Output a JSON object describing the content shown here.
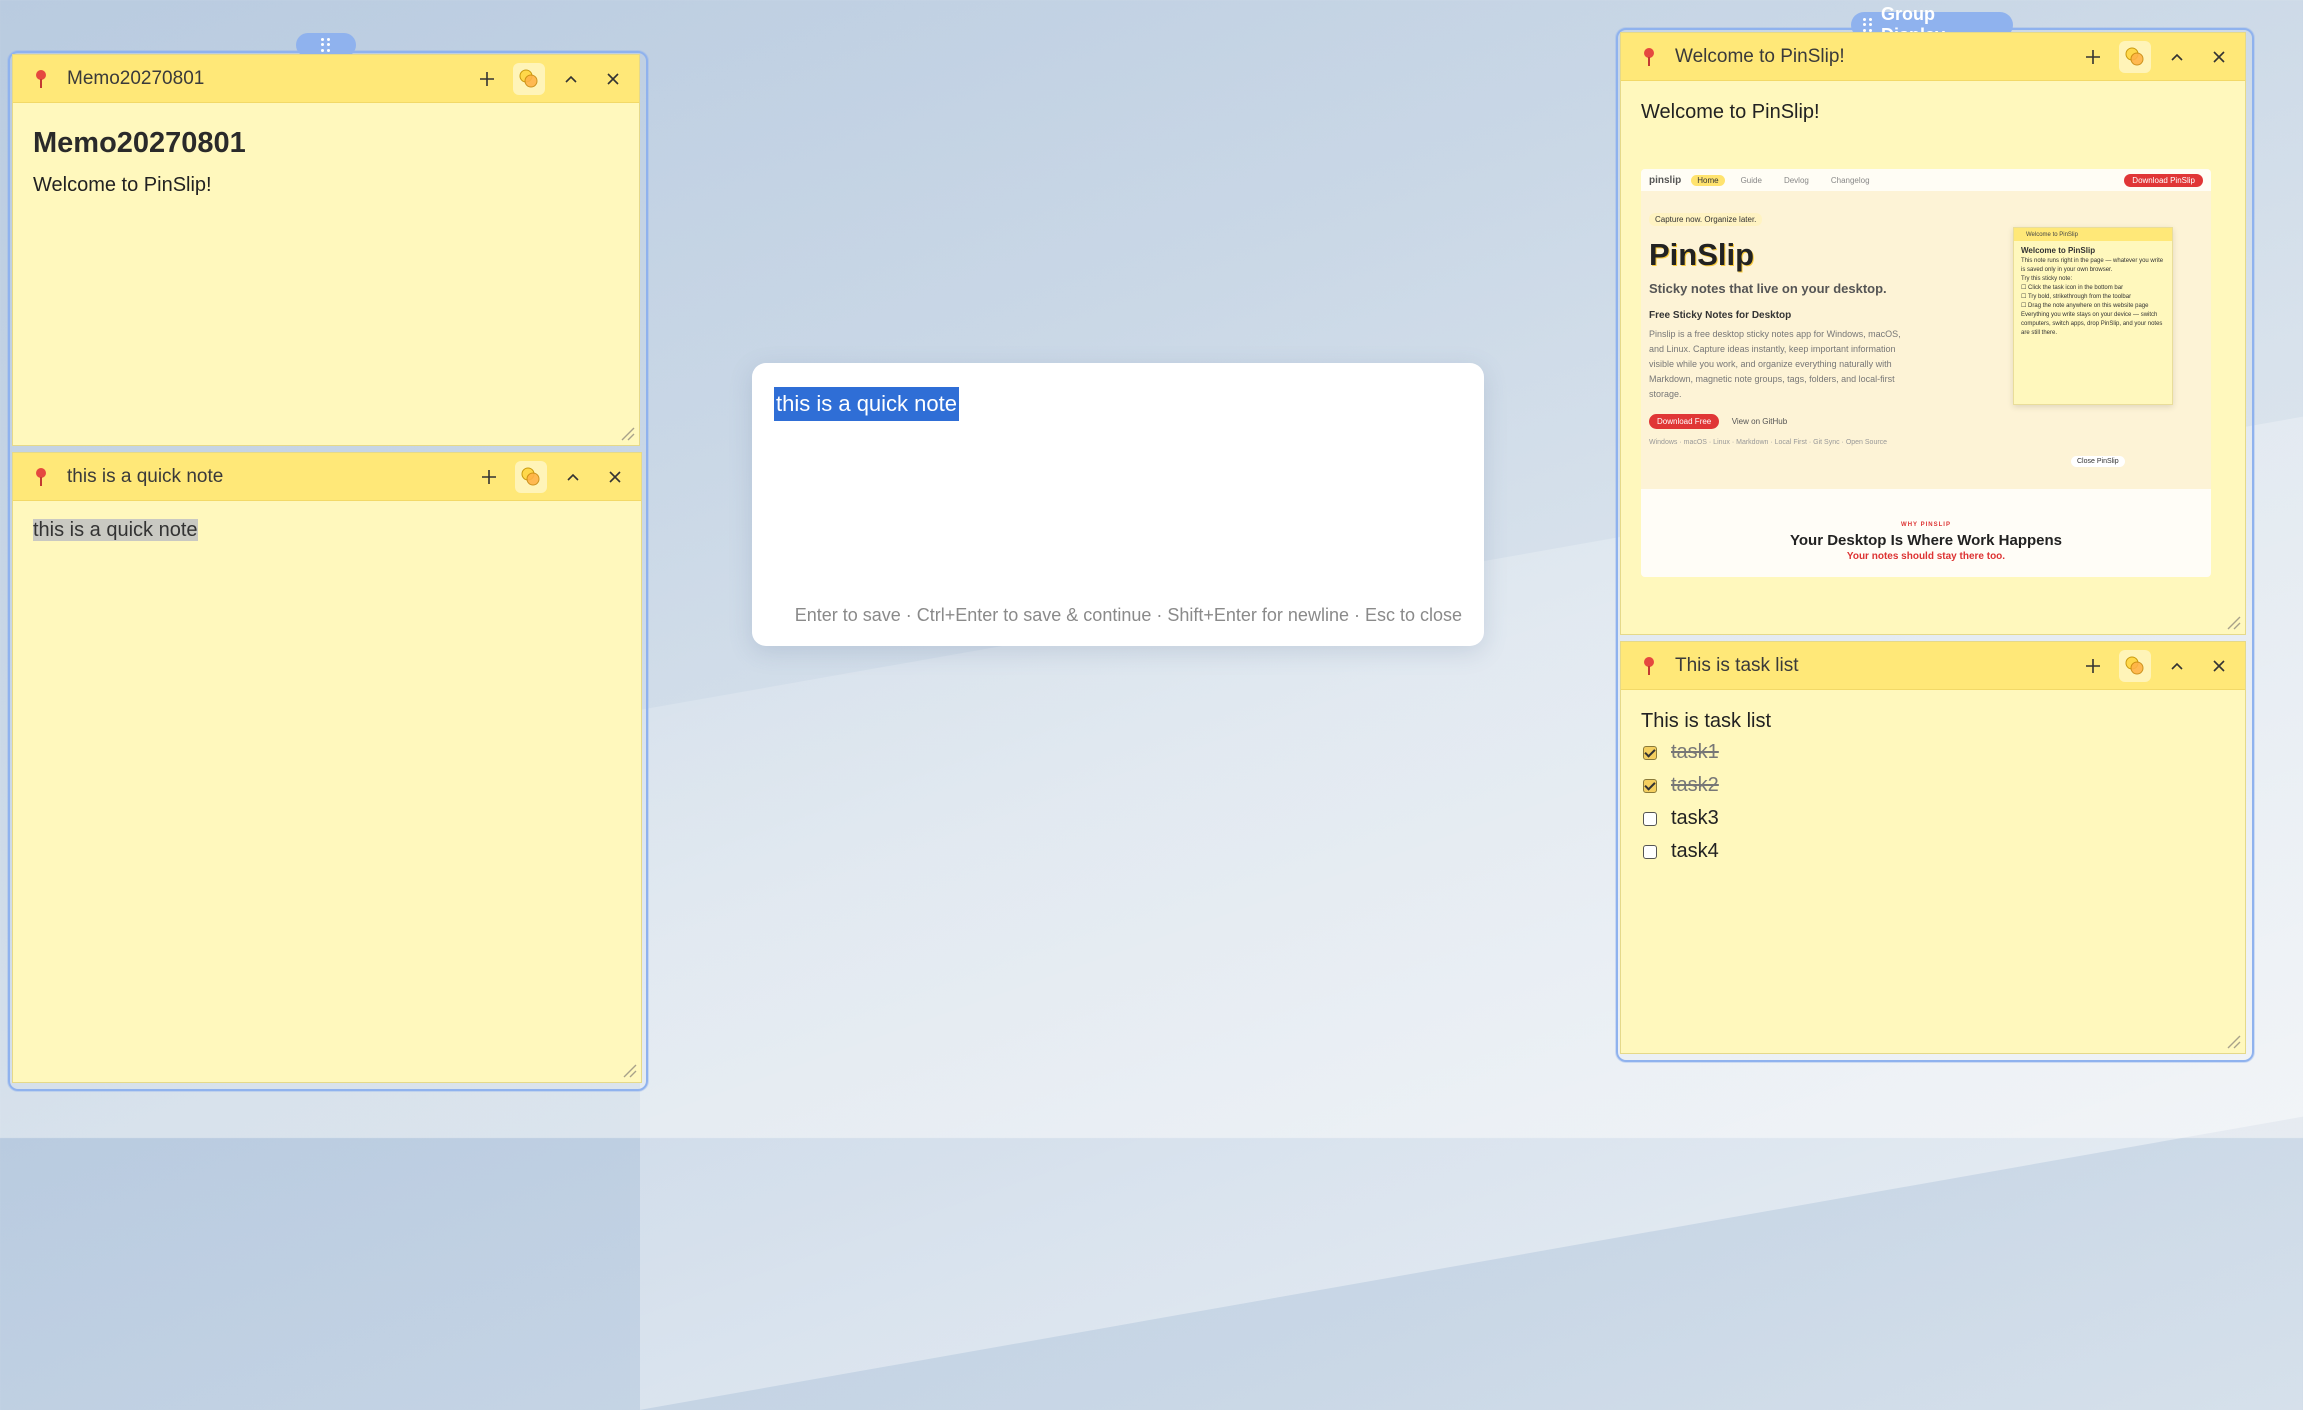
{
  "group_display": {
    "label": "Group Display"
  },
  "notes": {
    "memo": {
      "title": "Memo20270801",
      "heading": "Memo20270801",
      "text": "Welcome to PinSlip!"
    },
    "quick_note": {
      "title": "this is a quick note",
      "text": "this is a quick note"
    },
    "welcome": {
      "title": "Welcome to PinSlip!",
      "text": "Welcome to PinSlip!",
      "preview": {
        "logo": "pinslip",
        "nav": [
          "Home",
          "Guide",
          "Devlog",
          "Changelog"
        ],
        "download": "Download PinSlip",
        "badge": "Capture now. Organize later.",
        "brand": "PinSlip",
        "tagline": "Sticky notes that live on your desktop.",
        "subheading": "Free Sticky Notes for Desktop",
        "paragraph": "Pinslip is a free desktop sticky notes app for Windows, macOS, and Linux. Capture ideas instantly, keep important information visible while you work, and organize everything naturally with Markdown, magnetic note groups, tags, folders, and local-first storage.",
        "download_free": "Download Free",
        "github": "View on GitHub",
        "footer": "Windows · macOS · Linux · Markdown · Local First · Git Sync · Open Source",
        "card_title": "Welcome to PinSlip",
        "card_heading": "Welcome to PinSlip",
        "card_lines": [
          "This note runs right in the page — whatever you write is saved only in your own browser.",
          "Try this sticky note:",
          "☐ Click the task icon in the bottom bar",
          "☐ Try bold, strikethrough from the toolbar",
          "☐ Drag the note anywhere on this website page",
          "Everything you write stays on your device — switch computers, switch apps, drop PinSlip, and your notes are still there."
        ],
        "close": "Close PinSlip",
        "why": "WHY PINSLIP",
        "headline": "Your Desktop Is Where Work Happens",
        "red_line": "Your notes should stay there too."
      }
    },
    "tasks": {
      "title": "This is task list",
      "text": "This is task list",
      "items": [
        {
          "label": "task1",
          "done": true
        },
        {
          "label": "task2",
          "done": true
        },
        {
          "label": "task3",
          "done": false
        },
        {
          "label": "task4",
          "done": false
        }
      ]
    }
  },
  "quick_entry": {
    "text": "this is a quick note",
    "hint": "Enter to save · Ctrl+Enter to save & continue · Shift+Enter for newline · Esc to close"
  },
  "colors": {
    "accent": "#8fb2ee",
    "note_body": "#fff8bd",
    "note_header": "#ffe878",
    "selection": "#2f6ed6"
  }
}
